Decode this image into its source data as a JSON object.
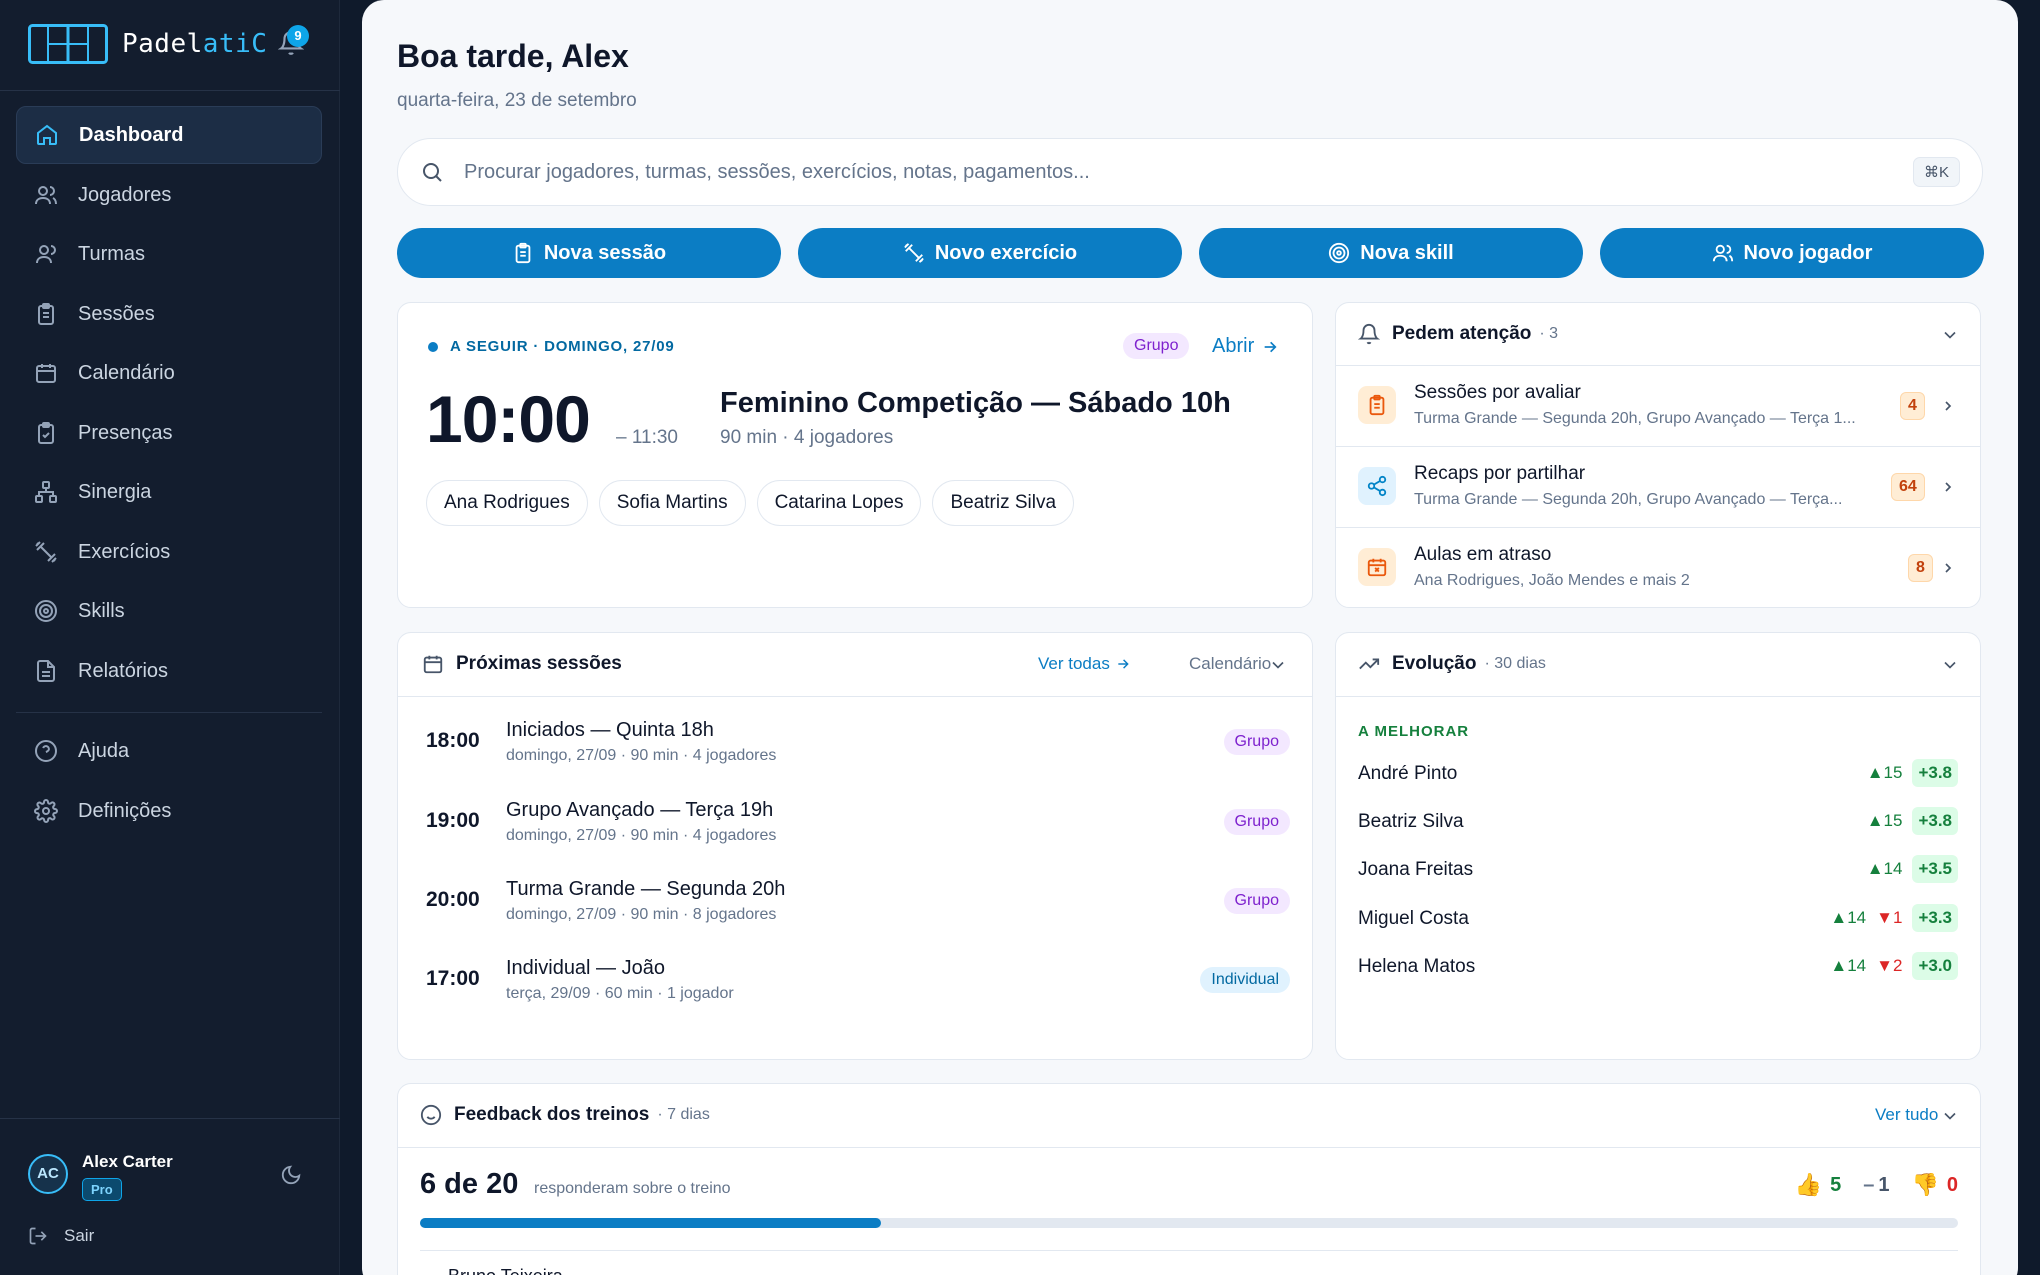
{
  "brand": {
    "name_part1": "Padel",
    "name_part2": "atiC",
    "notifications": "9"
  },
  "nav": {
    "items": [
      {
        "label": "Dashboard",
        "icon": "home-icon"
      },
      {
        "label": "Jogadores",
        "icon": "users-icon"
      },
      {
        "label": "Turmas",
        "icon": "user-icon"
      },
      {
        "label": "Sessões",
        "icon": "clipboard-icon"
      },
      {
        "label": "Calendário",
        "icon": "calendar-icon"
      },
      {
        "label": "Presenças",
        "icon": "clipboard-check-icon"
      },
      {
        "label": "Sinergia",
        "icon": "network-icon"
      },
      {
        "label": "Exercícios",
        "icon": "dumbbell-icon"
      },
      {
        "label": "Skills",
        "icon": "target-icon"
      },
      {
        "label": "Relatórios",
        "icon": "file-text-icon"
      }
    ],
    "secondary": [
      {
        "label": "Ajuda",
        "icon": "help-icon"
      },
      {
        "label": "Definições",
        "icon": "gear-icon"
      }
    ]
  },
  "user": {
    "initials": "AC",
    "name": "Alex Carter",
    "plan": "Pro",
    "logout": "Sair"
  },
  "header": {
    "greeting": "Boa tarde, Alex",
    "date": "quarta-feira, 23 de setembro"
  },
  "search": {
    "placeholder": "Procurar jogadores, turmas, sessões, exercícios, notas, pagamentos...",
    "shortcut": "⌘K"
  },
  "quick_actions": [
    "Nova sessão",
    "Novo exercício",
    "Nova skill",
    "Novo jogador"
  ],
  "next_session": {
    "label": "A SEGUIR · DOMINGO, 27/09",
    "tag": "Grupo",
    "open": "Abrir",
    "start": "10:00",
    "end": "– 11:30",
    "title": "Feminino Competição — Sábado 10h",
    "meta": "90 min · 4 jogadores",
    "players": [
      "Ana Rodrigues",
      "Sofia Martins",
      "Catarina Lopes",
      "Beatriz Silva"
    ]
  },
  "attention": {
    "title": "Pedem atenção",
    "count": "· 3",
    "items": [
      {
        "title": "Sessões por avaliar",
        "sub": "Turma Grande — Segunda 20h, Grupo Avançado — Terça 1...",
        "count": "4",
        "color": "#ea580c"
      },
      {
        "title": "Recaps por partilhar",
        "sub": "Turma Grande — Segunda 20h, Grupo Avançado — Terça...",
        "count": "64",
        "color": "#0284c7"
      },
      {
        "title": "Aulas em atraso",
        "sub": "Ana Rodrigues, João Mendes e mais 2",
        "count": "8",
        "color": "#ea580c"
      }
    ]
  },
  "upcoming": {
    "title": "Próximas sessões",
    "view_all": "Ver todas",
    "calendar": "Calendário",
    "sessions": [
      {
        "time": "18:00",
        "title": "Iniciados — Quinta 18h",
        "meta": "domingo, 27/09 · 90 min · 4 jogadores",
        "tag": "Grupo"
      },
      {
        "time": "19:00",
        "title": "Grupo Avançado — Terça 19h",
        "meta": "domingo, 27/09 · 90 min · 4 jogadores",
        "tag": "Grupo"
      },
      {
        "time": "20:00",
        "title": "Turma Grande — Segunda 20h",
        "meta": "domingo, 27/09 · 90 min · 8 jogadores",
        "tag": "Grupo"
      },
      {
        "time": "17:00",
        "title": "Individual — João",
        "meta": "terça, 29/09 · 60 min · 1 jogador",
        "tag": "Individual"
      }
    ]
  },
  "evolution": {
    "title": "Evolução",
    "period": "· 30 dias",
    "section": "A MELHORAR",
    "players": [
      {
        "name": "André Pinto",
        "up": "▲15",
        "down": "",
        "gain": "+3.8"
      },
      {
        "name": "Beatriz Silva",
        "up": "▲15",
        "down": "",
        "gain": "+3.8"
      },
      {
        "name": "Joana Freitas",
        "up": "▲14",
        "down": "",
        "gain": "+3.5"
      },
      {
        "name": "Miguel Costa",
        "up": "▲14",
        "down": "▼1",
        "gain": "+3.3"
      },
      {
        "name": "Helena Matos",
        "up": "▲14",
        "down": "▼2",
        "gain": "+3.0"
      }
    ]
  },
  "feedback": {
    "title": "Feedback dos treinos",
    "period": "· 7 dias",
    "view_all": "Ver tudo",
    "responded": "6 de 20",
    "responded_label": "responderam sobre o treino",
    "positive": "5",
    "neutral": "1",
    "negative": "0",
    "progress": 0.3,
    "next_item": "Bruno Teixeira"
  },
  "colors": {
    "accent": "#0b7dc4",
    "sidebar": "#131d2e",
    "positive": "#15803d",
    "negative": "#dc2626",
    "warning": "#ea580c"
  }
}
